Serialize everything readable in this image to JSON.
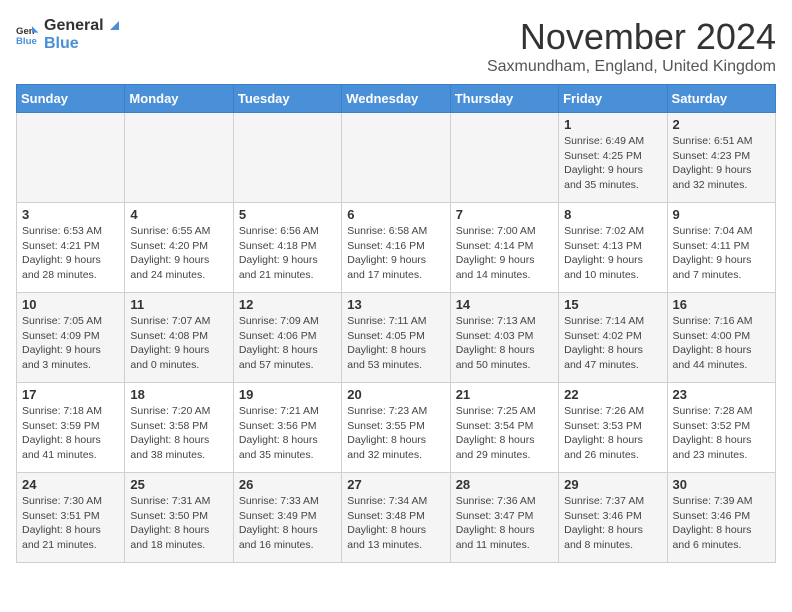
{
  "header": {
    "logo": {
      "general": "General",
      "blue": "Blue"
    },
    "title": "November 2024",
    "subtitle": "Saxmundham, England, United Kingdom"
  },
  "weekdays": [
    "Sunday",
    "Monday",
    "Tuesday",
    "Wednesday",
    "Thursday",
    "Friday",
    "Saturday"
  ],
  "weeks": [
    [
      {
        "day": "",
        "info": ""
      },
      {
        "day": "",
        "info": ""
      },
      {
        "day": "",
        "info": ""
      },
      {
        "day": "",
        "info": ""
      },
      {
        "day": "",
        "info": ""
      },
      {
        "day": "1",
        "info": "Sunrise: 6:49 AM\nSunset: 4:25 PM\nDaylight: 9 hours and 35 minutes."
      },
      {
        "day": "2",
        "info": "Sunrise: 6:51 AM\nSunset: 4:23 PM\nDaylight: 9 hours and 32 minutes."
      }
    ],
    [
      {
        "day": "3",
        "info": "Sunrise: 6:53 AM\nSunset: 4:21 PM\nDaylight: 9 hours and 28 minutes."
      },
      {
        "day": "4",
        "info": "Sunrise: 6:55 AM\nSunset: 4:20 PM\nDaylight: 9 hours and 24 minutes."
      },
      {
        "day": "5",
        "info": "Sunrise: 6:56 AM\nSunset: 4:18 PM\nDaylight: 9 hours and 21 minutes."
      },
      {
        "day": "6",
        "info": "Sunrise: 6:58 AM\nSunset: 4:16 PM\nDaylight: 9 hours and 17 minutes."
      },
      {
        "day": "7",
        "info": "Sunrise: 7:00 AM\nSunset: 4:14 PM\nDaylight: 9 hours and 14 minutes."
      },
      {
        "day": "8",
        "info": "Sunrise: 7:02 AM\nSunset: 4:13 PM\nDaylight: 9 hours and 10 minutes."
      },
      {
        "day": "9",
        "info": "Sunrise: 7:04 AM\nSunset: 4:11 PM\nDaylight: 9 hours and 7 minutes."
      }
    ],
    [
      {
        "day": "10",
        "info": "Sunrise: 7:05 AM\nSunset: 4:09 PM\nDaylight: 9 hours and 3 minutes."
      },
      {
        "day": "11",
        "info": "Sunrise: 7:07 AM\nSunset: 4:08 PM\nDaylight: 9 hours and 0 minutes."
      },
      {
        "day": "12",
        "info": "Sunrise: 7:09 AM\nSunset: 4:06 PM\nDaylight: 8 hours and 57 minutes."
      },
      {
        "day": "13",
        "info": "Sunrise: 7:11 AM\nSunset: 4:05 PM\nDaylight: 8 hours and 53 minutes."
      },
      {
        "day": "14",
        "info": "Sunrise: 7:13 AM\nSunset: 4:03 PM\nDaylight: 8 hours and 50 minutes."
      },
      {
        "day": "15",
        "info": "Sunrise: 7:14 AM\nSunset: 4:02 PM\nDaylight: 8 hours and 47 minutes."
      },
      {
        "day": "16",
        "info": "Sunrise: 7:16 AM\nSunset: 4:00 PM\nDaylight: 8 hours and 44 minutes."
      }
    ],
    [
      {
        "day": "17",
        "info": "Sunrise: 7:18 AM\nSunset: 3:59 PM\nDaylight: 8 hours and 41 minutes."
      },
      {
        "day": "18",
        "info": "Sunrise: 7:20 AM\nSunset: 3:58 PM\nDaylight: 8 hours and 38 minutes."
      },
      {
        "day": "19",
        "info": "Sunrise: 7:21 AM\nSunset: 3:56 PM\nDaylight: 8 hours and 35 minutes."
      },
      {
        "day": "20",
        "info": "Sunrise: 7:23 AM\nSunset: 3:55 PM\nDaylight: 8 hours and 32 minutes."
      },
      {
        "day": "21",
        "info": "Sunrise: 7:25 AM\nSunset: 3:54 PM\nDaylight: 8 hours and 29 minutes."
      },
      {
        "day": "22",
        "info": "Sunrise: 7:26 AM\nSunset: 3:53 PM\nDaylight: 8 hours and 26 minutes."
      },
      {
        "day": "23",
        "info": "Sunrise: 7:28 AM\nSunset: 3:52 PM\nDaylight: 8 hours and 23 minutes."
      }
    ],
    [
      {
        "day": "24",
        "info": "Sunrise: 7:30 AM\nSunset: 3:51 PM\nDaylight: 8 hours and 21 minutes."
      },
      {
        "day": "25",
        "info": "Sunrise: 7:31 AM\nSunset: 3:50 PM\nDaylight: 8 hours and 18 minutes."
      },
      {
        "day": "26",
        "info": "Sunrise: 7:33 AM\nSunset: 3:49 PM\nDaylight: 8 hours and 16 minutes."
      },
      {
        "day": "27",
        "info": "Sunrise: 7:34 AM\nSunset: 3:48 PM\nDaylight: 8 hours and 13 minutes."
      },
      {
        "day": "28",
        "info": "Sunrise: 7:36 AM\nSunset: 3:47 PM\nDaylight: 8 hours and 11 minutes."
      },
      {
        "day": "29",
        "info": "Sunrise: 7:37 AM\nSunset: 3:46 PM\nDaylight: 8 hours and 8 minutes."
      },
      {
        "day": "30",
        "info": "Sunrise: 7:39 AM\nSunset: 3:46 PM\nDaylight: 8 hours and 6 minutes."
      }
    ]
  ]
}
